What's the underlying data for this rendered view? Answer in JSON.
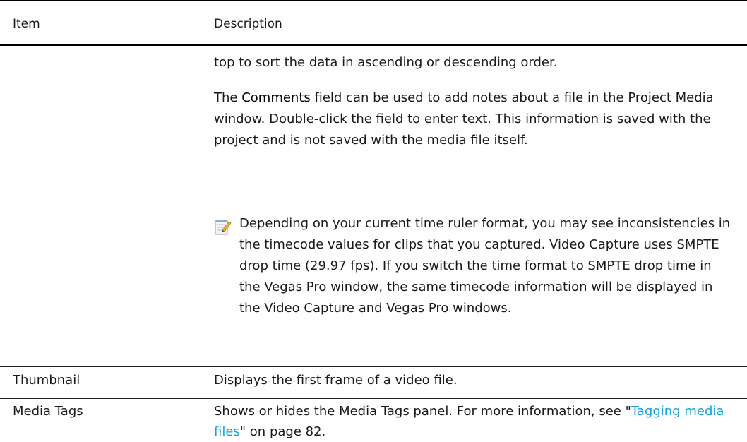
{
  "table": {
    "headers": {
      "item": "Item",
      "description": "Description"
    },
    "continued_row": {
      "line1": "top to sort the data in ascending or descending order.",
      "comments_para": {
        "prefix": "The ",
        "strong": "Comments",
        "suffix": " field can be used to add notes about a file in the Project Media window. Double-click the field to enter text. This information is saved with the project and is not saved with the media file itself."
      },
      "note": {
        "icon": "note-icon",
        "text": "Depending on your current time ruler format, you may see inconsistencies in the timecode values for clips that you captured. Video Capture uses SMPTE drop time (29.97 fps). If you switch the time format to SMPTE drop time in the Vegas Pro window, the same timecode information will be displayed in the Video Capture and Vegas Pro windows."
      }
    },
    "rows": [
      {
        "item": "Thumbnail",
        "description": "Displays the first frame of a video file."
      },
      {
        "item": "Media Tags",
        "description_prefix": "Shows or hides the Media Tags panel. For more information, see \"",
        "link": "Tagging media files",
        "description_suffix": "\" on page 82."
      }
    ]
  },
  "colors": {
    "link": "#1aa3d9",
    "rule": "#000000"
  }
}
